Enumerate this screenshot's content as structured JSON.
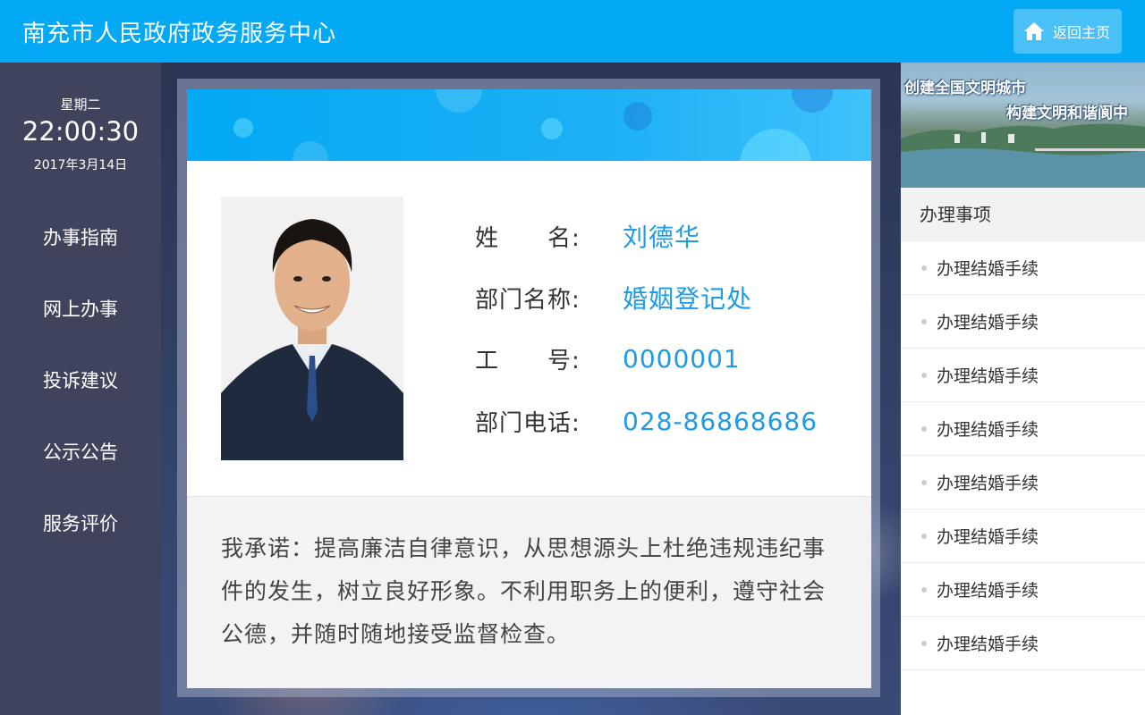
{
  "header": {
    "title": "南充市人民政府政务服务中心",
    "home_label": "返回主页"
  },
  "clock": {
    "weekday": "星期二",
    "time": "22:00:30",
    "date": "2017年3月14日"
  },
  "nav": {
    "items": [
      {
        "label": "办事指南"
      },
      {
        "label": "网上办事"
      },
      {
        "label": "投诉建议"
      },
      {
        "label": "公示公告"
      },
      {
        "label": "服务评价"
      }
    ]
  },
  "profile": {
    "name_label": "姓　　名:",
    "name_value": "刘德华",
    "dept_label": "部门名称:",
    "dept_value": "婚姻登记处",
    "id_label": "工　　号:",
    "id_value": "0000001",
    "phone_label": "部门电话:",
    "phone_value": "028-86868686",
    "pledge": "我承诺：提高廉洁自律意识，从思想源头上杜绝违规违纪事件的发生，树立良好形象。不利用职务上的便利，遵守社会公德，并随时随地接受监督检查。"
  },
  "right": {
    "slogan_line1": "创建全国文明城市",
    "slogan_line2": "构建文明和谐阆中",
    "section_title": "办理事项",
    "tasks": [
      {
        "label": "办理结婚手续"
      },
      {
        "label": "办理结婚手续"
      },
      {
        "label": "办理结婚手续"
      },
      {
        "label": "办理结婚手续"
      },
      {
        "label": "办理结婚手续"
      },
      {
        "label": "办理结婚手续"
      },
      {
        "label": "办理结婚手续"
      },
      {
        "label": "办理结婚手续"
      }
    ]
  },
  "colors": {
    "accent": "#03a9f4",
    "sidebar": "#40435c",
    "value_text": "#1d9be6"
  }
}
